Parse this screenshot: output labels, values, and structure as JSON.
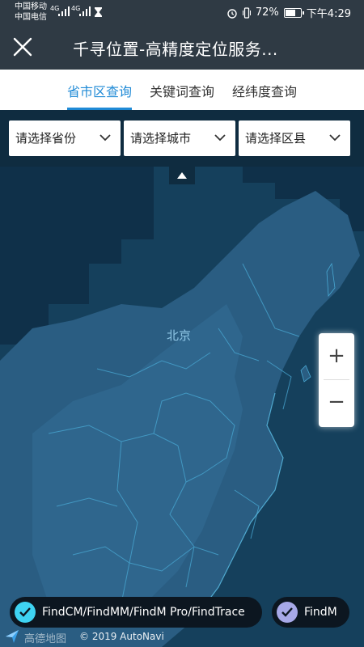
{
  "status_bar": {
    "carrier_1": "中国移动",
    "carrier_2": "中国电信",
    "network_1": "4G",
    "network_2": "4G",
    "battery_percent": "72%",
    "battery_level": 0.72,
    "time": "下午4:29"
  },
  "header": {
    "title": "千寻位置-高精度定位服务...",
    "close_icon": "close-icon"
  },
  "tabs": [
    {
      "label": "省市区查询",
      "active": true
    },
    {
      "label": "关键词查询",
      "active": false
    },
    {
      "label": "经纬度查询",
      "active": false
    }
  ],
  "filters": {
    "province": "请选择省份",
    "city": "请选择城市",
    "district": "请选择区县"
  },
  "map": {
    "city_label": "北京",
    "zoom_in": "+",
    "zoom_out": "−"
  },
  "chips": [
    {
      "label": "FindCM/FindMM/FindM Pro/FindTrace",
      "checked": true,
      "color": "#3ed3f2"
    },
    {
      "label": "FindM",
      "checked": true,
      "color": "#a7a9e8"
    }
  ],
  "attribution": {
    "logo_text": "高德地图",
    "copyright": "© 2019 AutoNavi"
  },
  "colors": {
    "accent": "#1f8ad6",
    "header_bg": "#2f3a44"
  }
}
